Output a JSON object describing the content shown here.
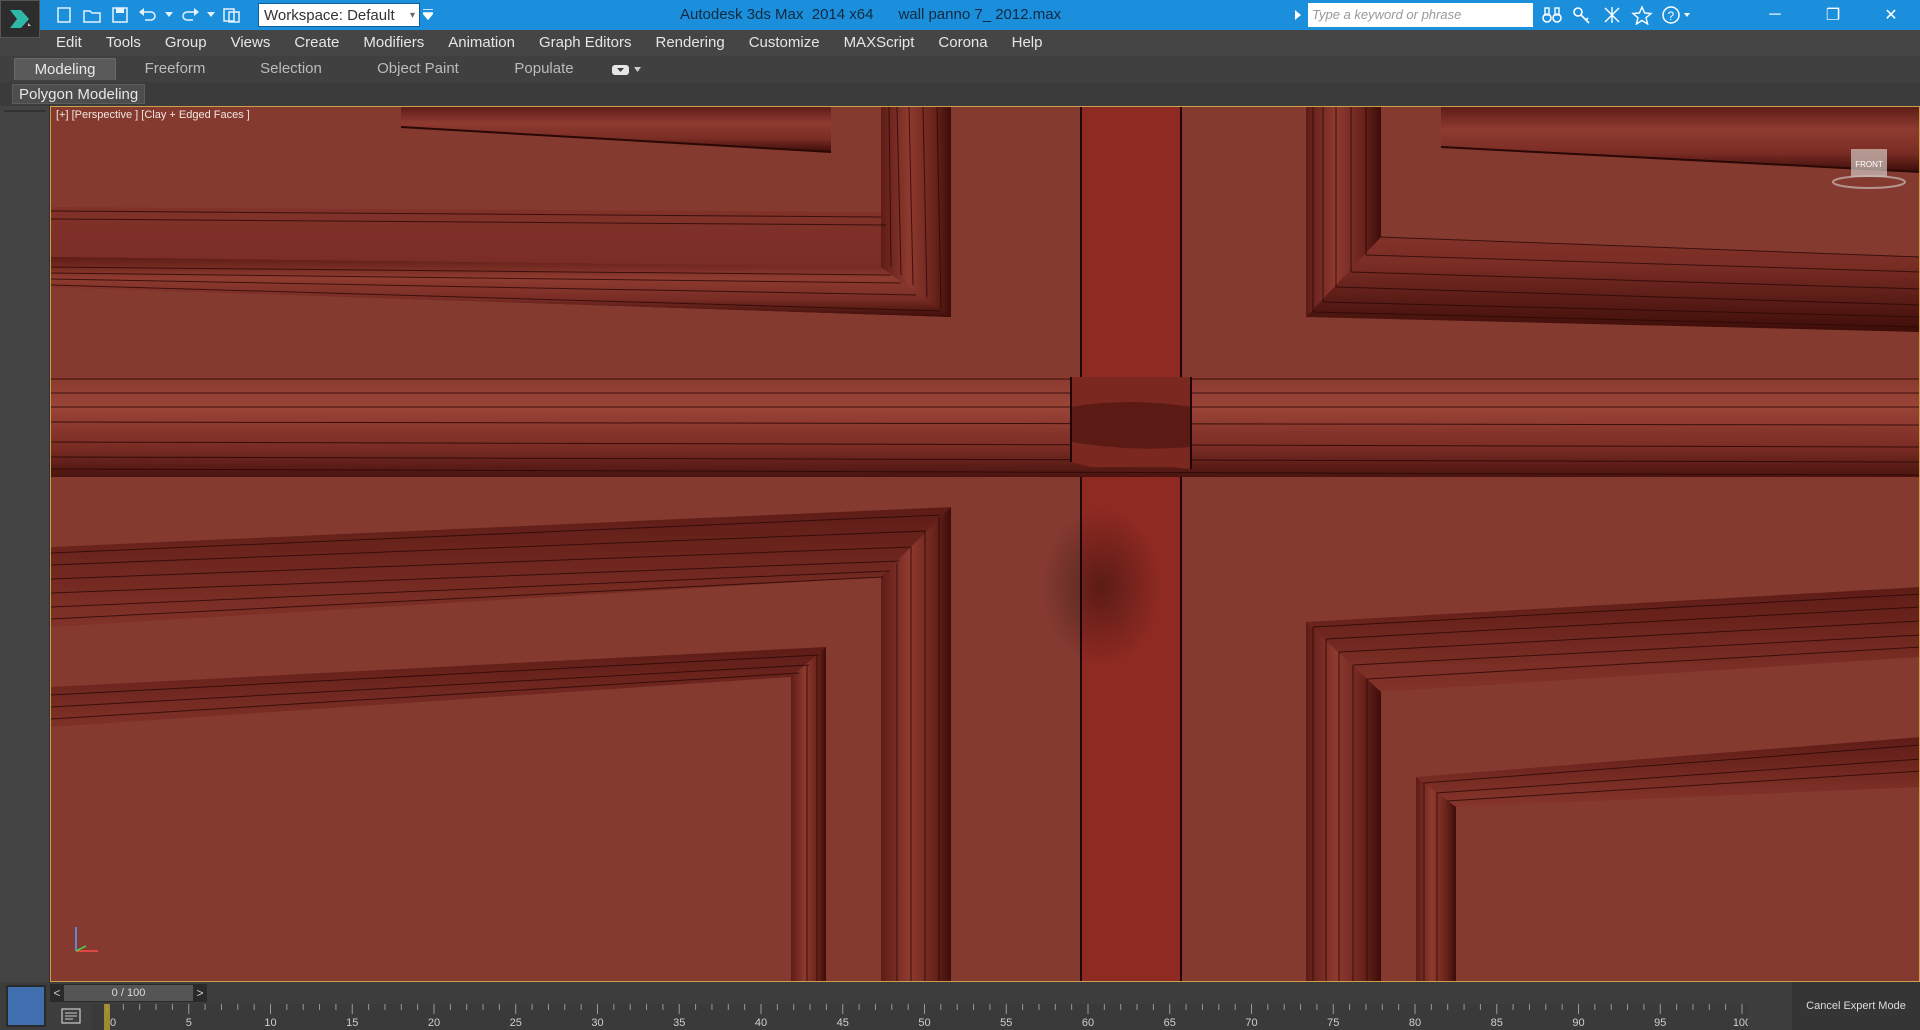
{
  "titlebar": {
    "workspace": "Workspace: Default",
    "title": "Autodesk 3ds Max  2014 x64      wall panno 7_ 2012.max",
    "search_placeholder": "Type a keyword or phrase"
  },
  "menu": [
    "Edit",
    "Tools",
    "Group",
    "Views",
    "Create",
    "Modifiers",
    "Animation",
    "Graph Editors",
    "Rendering",
    "Customize",
    "MAXScript",
    "Corona",
    "Help"
  ],
  "ribbon": {
    "tabs": [
      "Modeling",
      "Freeform",
      "Selection",
      "Object Paint",
      "Populate"
    ],
    "panel_label": "Polygon Modeling"
  },
  "viewport": {
    "label": "[+] [Perspective ] [Clay + Edged Faces ]",
    "viewcube_face": "FRONT",
    "colors": {
      "background": "#85392f",
      "wire": "#1e0604",
      "stile": "#8e2a22"
    }
  },
  "timeline": {
    "slider_value": "0 / 100",
    "ticks": [
      "0",
      "5",
      "10",
      "15",
      "20",
      "25",
      "30",
      "35",
      "40",
      "45",
      "50",
      "55",
      "60",
      "65",
      "70",
      "75",
      "80",
      "85",
      "90",
      "95",
      "100"
    ]
  },
  "status": {
    "expert_mode_button": "Cancel Expert Mode"
  },
  "colors": {
    "titlebar": "#1b8fdc",
    "accent_border": "#c9a24b"
  }
}
